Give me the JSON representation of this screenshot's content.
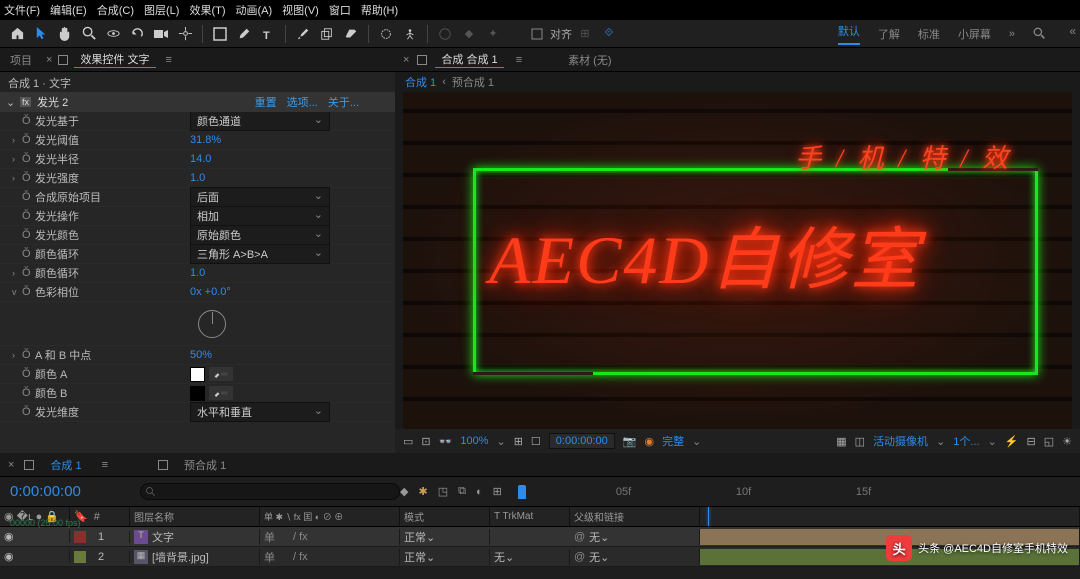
{
  "menu": {
    "items": [
      "文件(F)",
      "编辑(E)",
      "合成(C)",
      "图层(L)",
      "效果(T)",
      "动画(A)",
      "视图(V)",
      "窗口",
      "帮助(H)"
    ]
  },
  "workspace": {
    "tabs": [
      "默认",
      "了解",
      "标准",
      "小屏幕"
    ],
    "active": 0
  },
  "leftPanel": {
    "tab1": "项目",
    "tab2_prefix": "效果控件",
    "tab2_blue": "文字",
    "breadcrumb": "合成 1 · 文字"
  },
  "effect": {
    "name": "发光 2",
    "links": {
      "reset": "重置",
      "options": "选项...",
      "about": "关于..."
    },
    "props": [
      {
        "tw": "",
        "label": "发光基于",
        "type": "dd",
        "val": "颜色通道"
      },
      {
        "tw": "›",
        "label": "发光阈值",
        "type": "num",
        "val": "31.8%"
      },
      {
        "tw": "›",
        "label": "发光半径",
        "type": "num",
        "val": "14.0"
      },
      {
        "tw": "›",
        "label": "发光强度",
        "type": "num",
        "val": "1.0"
      },
      {
        "tw": "",
        "label": "合成原始项目",
        "type": "dd",
        "val": "后面"
      },
      {
        "tw": "",
        "label": "发光操作",
        "type": "dd",
        "val": "相加"
      },
      {
        "tw": "",
        "label": "发光颜色",
        "type": "dd",
        "val": "原始颜色"
      },
      {
        "tw": "",
        "label": "颜色循环",
        "type": "dd",
        "val": "三角形 A>B>A"
      },
      {
        "tw": "›",
        "label": "颜色循环",
        "type": "num",
        "val": "1.0"
      },
      {
        "tw": "v",
        "label": "色彩相位",
        "type": "num",
        "val": "0x +0.0°"
      }
    ],
    "dial": true,
    "props2": [
      {
        "tw": "›",
        "label": "A 和 B 中点",
        "type": "num",
        "val": "50%"
      },
      {
        "tw": "",
        "label": "颜色 A",
        "type": "color",
        "val": "#ffffff"
      },
      {
        "tw": "",
        "label": "颜色 B",
        "type": "color",
        "val": "#000000"
      },
      {
        "tw": "",
        "label": "发光维度",
        "type": "dd",
        "val": "水平和垂直"
      }
    ]
  },
  "viewer": {
    "tab_prefix": "合成",
    "tab_blue": "合成 1",
    "tab2": "素材  (无)",
    "bc1": "合成 1",
    "bc2": "预合成 1",
    "neon_sub": "手 / 机 / 特 / 效",
    "neon_main": "AEC4D自修室",
    "footer": {
      "zoom": "100%",
      "time": "0:00:00:00",
      "quality": "完整",
      "camera": "活动摄像机",
      "views": "1个..."
    }
  },
  "timeline": {
    "tab1": "合成 1",
    "tab2": "预合成 1",
    "timecode": "0:00:00:00",
    "fps": "00000 (25.00 fps)",
    "cols": {
      "name": "图层名称",
      "switches": "单#*fx",
      "mode": "模式",
      "trk": "T TrkMat",
      "parent": "父级和链接"
    },
    "ruler": [
      "05f",
      "10f",
      "15f"
    ],
    "layers": [
      {
        "num": "1",
        "name": "文字",
        "mode": "正常",
        "trk": "",
        "parent": "无",
        "color": "#8b2e2e"
      },
      {
        "num": "2",
        "name": "[墙背景.jpg]",
        "mode": "正常",
        "trk": "无",
        "parent": "无",
        "color": "#6a7a3a"
      }
    ]
  },
  "align_label": "对齐",
  "watermark": "头条 @AEC4D自修室手机特效"
}
